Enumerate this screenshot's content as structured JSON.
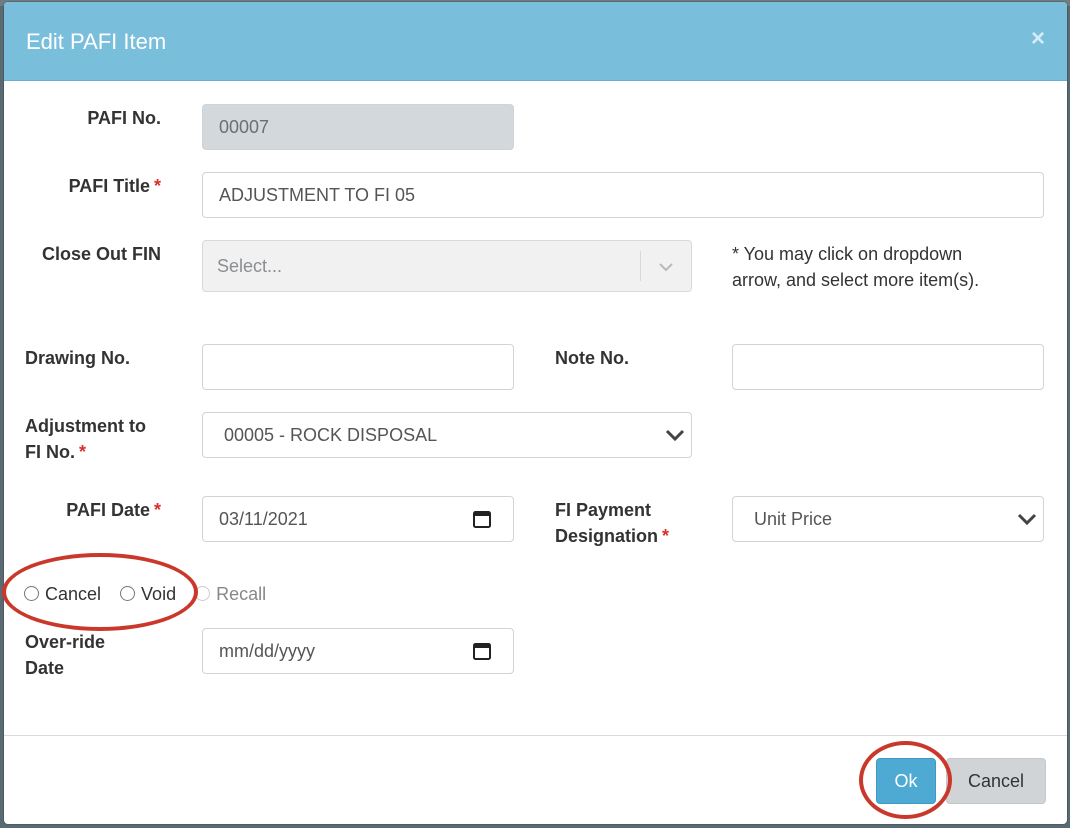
{
  "modal": {
    "title": "Edit PAFI Item",
    "close_glyph": "×"
  },
  "form": {
    "pafi_no": {
      "label": "PAFI No.",
      "value": "00007"
    },
    "pafi_title": {
      "label": "PAFI Title",
      "required": "*",
      "value": "ADJUSTMENT TO FI 05"
    },
    "close_out_fin": {
      "label": "Close Out FIN",
      "placeholder": "Select...",
      "hint_line1": "* You may click on dropdown",
      "hint_line2": "arrow, and select more item(s)."
    },
    "drawing_no": {
      "label": "Drawing No.",
      "value": ""
    },
    "note_no": {
      "label": "Note No.",
      "value": ""
    },
    "adjustment_to_fi": {
      "label_line1": "Adjustment to",
      "label_line2": "FI No.",
      "required": "*",
      "value": "00005 - ROCK DISPOSAL"
    },
    "pafi_date": {
      "label": "PAFI Date",
      "required": "*",
      "value": "03/11/2021"
    },
    "fi_payment_designation": {
      "label_line1": "FI Payment",
      "label_line2": "Designation",
      "required": "*",
      "value": "Unit Price"
    },
    "status_radios": {
      "cancel": "Cancel",
      "void": "Void",
      "recall": "Recall"
    },
    "override_date": {
      "label_line1": "Over-ride",
      "label_line2": "Date",
      "placeholder": "mm/dd/yyyy"
    }
  },
  "footer": {
    "ok_label": "Ok",
    "cancel_label": "Cancel"
  },
  "colors": {
    "header": "#79bfdc",
    "ok_button": "#4faad3",
    "annotation": "#c9382a",
    "required": "#d9302a"
  },
  "icons": [
    "close-icon",
    "chevron-down-icon",
    "calendar-icon"
  ]
}
